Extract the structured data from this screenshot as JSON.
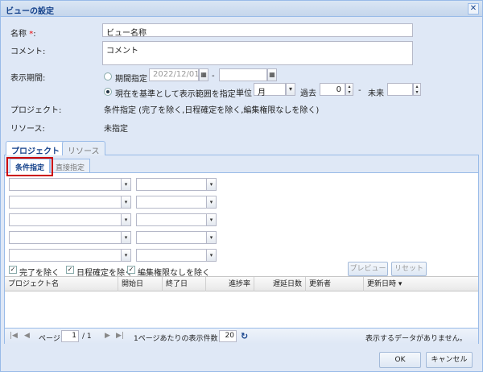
{
  "dialog": {
    "title": "ビューの設定"
  },
  "form": {
    "name_label": "名称",
    "name_required": "*",
    "name_colon": ":",
    "name_value": "ビュー名称",
    "comment_label": "コメント:",
    "comment_value": "コメント",
    "period_label": "表示期間:",
    "period_fixed_label": "期間指定",
    "period_from_value": "2022/12/01",
    "period_dash": "-",
    "period_to_value": "",
    "period_relative_label": "現在を基準として表示範囲を指定",
    "unit_label": "単位",
    "unit_value": "月",
    "past_label": "過去",
    "past_value": "0",
    "future_label": "未来",
    "future_value": "",
    "project_label": "プロジェクト:",
    "project_value": "条件指定 (完了を除く,日程確定を除く,編集権限なしを除く)",
    "resource_label": "リソース:",
    "resource_value": "未指定"
  },
  "tabs": [
    {
      "label": "プロジェクト",
      "active": true
    },
    {
      "label": "リソース",
      "active": false
    }
  ],
  "subtabs": [
    {
      "label": "条件指定",
      "active": true
    },
    {
      "label": "直接指定",
      "active": false
    }
  ],
  "filters": {
    "exclude_completed": "完了を除く",
    "exclude_schedule_fixed": "日程確定を除く",
    "exclude_no_edit": "編集権限なしを除く",
    "preview": "プレビュー",
    "reset": "リセット"
  },
  "grid": {
    "columns": [
      "プロジェクト名",
      "開始日",
      "終了日",
      "進捗率",
      "遅延日数",
      "更新者",
      "更新日時 ▾"
    ]
  },
  "pager": {
    "page_label": "ページ",
    "page_value": "1",
    "page_total": "/ 1",
    "per_page_label": "1ページあたりの表示件数",
    "per_page_value": "20",
    "empty_message": "表示するデータがありません。"
  },
  "footer": {
    "ok": "OK",
    "cancel": "キャンセル"
  },
  "icons": {
    "close": "✕",
    "calendar": "▦",
    "dropdown": "▾",
    "spin_up": "▴",
    "spin_down": "▾",
    "first": "|◀",
    "prev": "◀",
    "next": "▶",
    "last": "▶|",
    "refresh": "↻",
    "check": "✓"
  }
}
